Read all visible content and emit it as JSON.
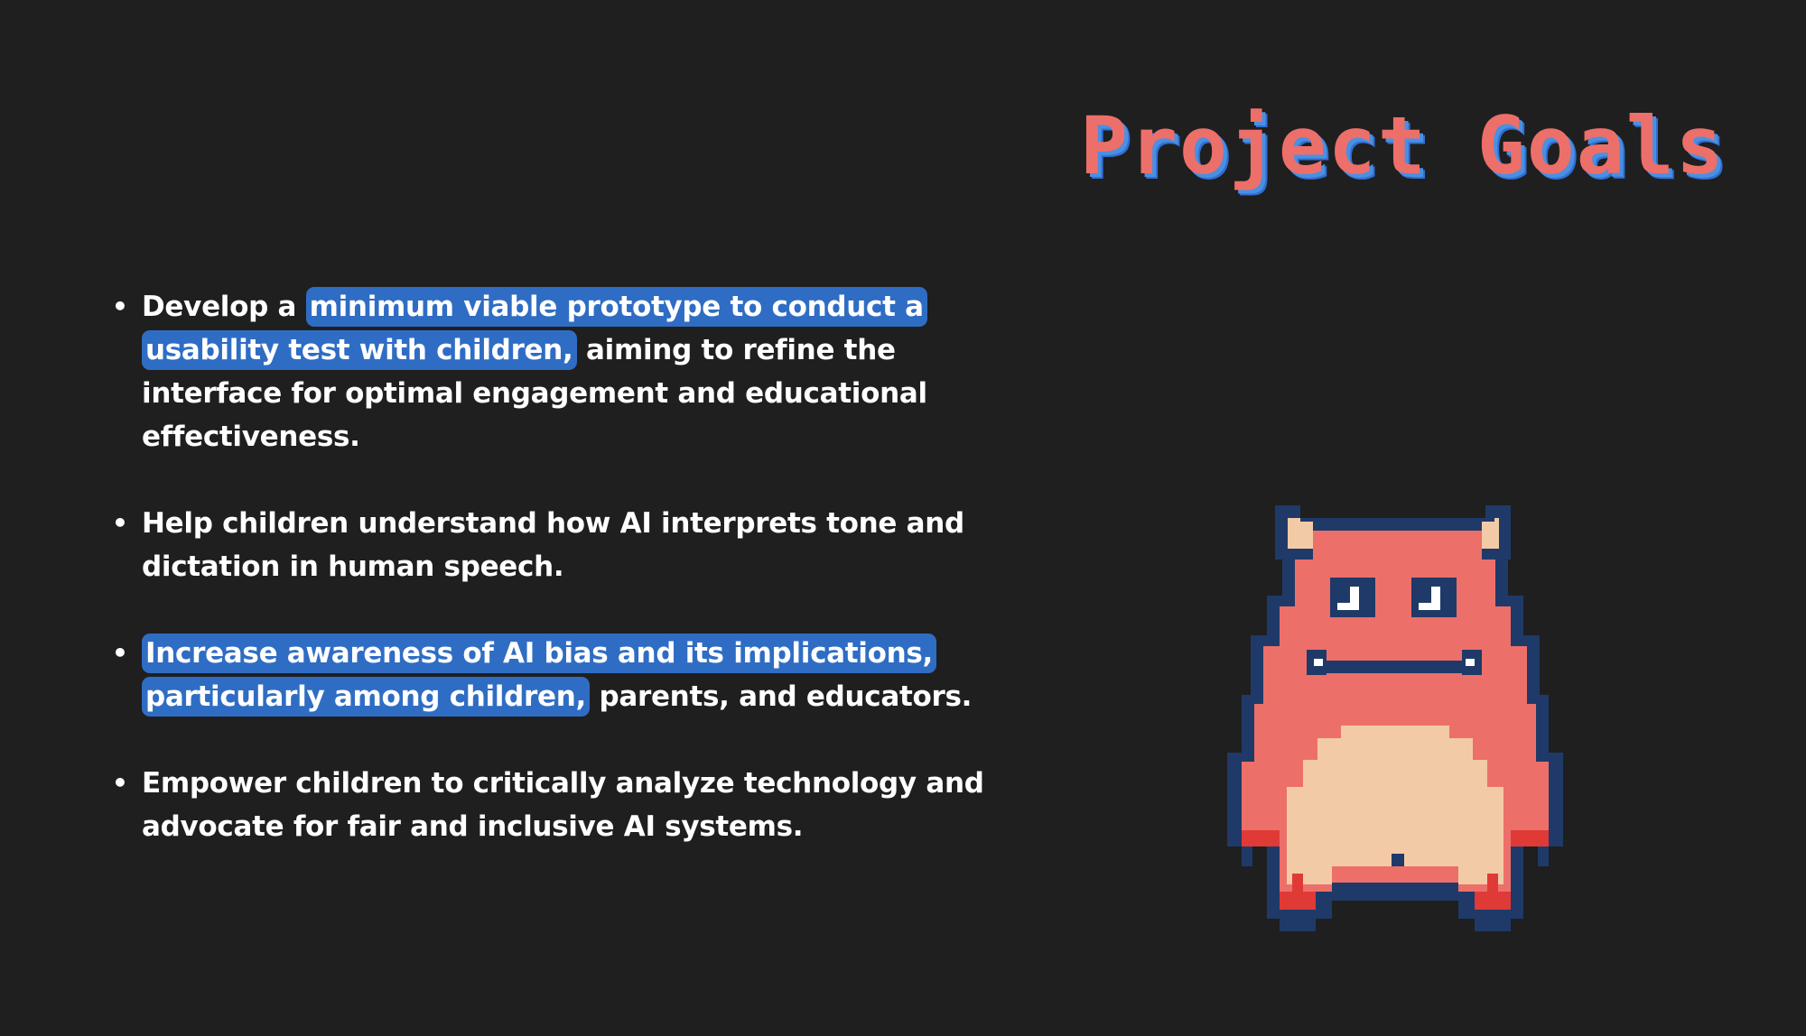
{
  "slide": {
    "title": "Project Goals",
    "goals": [
      {
        "before": "Develop a ",
        "highlight": "minimum viable prototype to conduct a usability test with children,",
        "after": " aiming to refine the interface for optimal engagement and educational effectiveness."
      },
      {
        "before": "",
        "highlight": "",
        "after": "Help children understand how AI interprets tone and dictation in human speech."
      },
      {
        "before": "",
        "highlight": "Increase awareness of AI bias and its implications, particularly among children,",
        "after": " parents, and educators."
      },
      {
        "before": "",
        "highlight": "",
        "after": "Empower children to critically analyze technology and advocate for fair and inclusive AI systems."
      }
    ],
    "bullet_char": "•",
    "mascot": "pixel-monster-icon"
  },
  "colors": {
    "background": "#1f1f1f",
    "title": "#ed6f6a",
    "title_shadow": "#4a90e2",
    "highlight": "#2f6dc4",
    "text": "#ffffff",
    "monster_body": "#ed6f6a",
    "monster_outline": "#1f3a68",
    "monster_belly": "#f2cba6",
    "monster_feet": "#e03a36"
  }
}
